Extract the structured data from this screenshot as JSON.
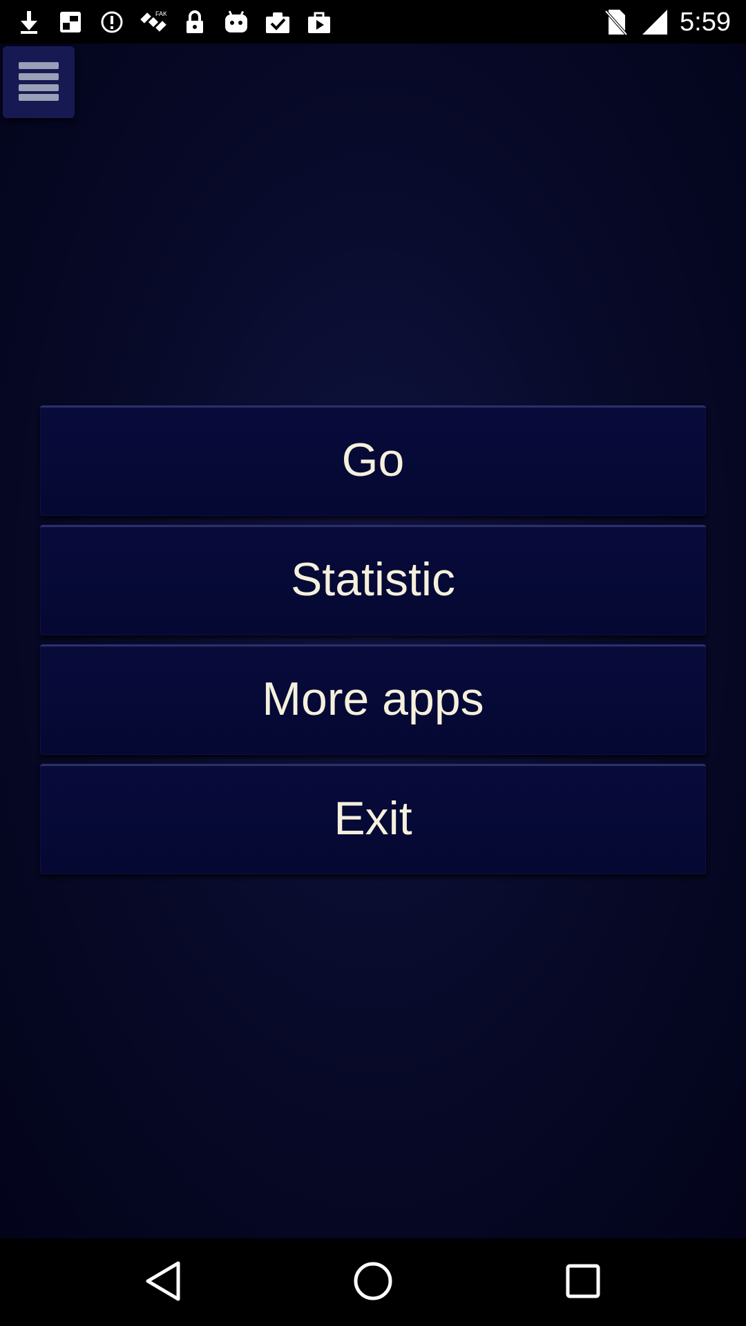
{
  "status_bar": {
    "time": "5:59",
    "left_icons": [
      "download-icon",
      "photos-icon",
      "alert-circle-icon",
      "satellite-icon",
      "lock-icon",
      "android-icon",
      "clipboard-check-icon",
      "bag-play-icon"
    ],
    "right_icons": [
      "no-sim-icon",
      "signal-icon"
    ]
  },
  "toolbar": {
    "menu_icon": "hamburger-menu-icon"
  },
  "menu": {
    "items": [
      {
        "label": "Go"
      },
      {
        "label": "Statistic"
      },
      {
        "label": "More apps"
      },
      {
        "label": "Exit"
      }
    ]
  },
  "nav_bar": {
    "buttons": [
      "back-icon",
      "home-icon",
      "recents-icon"
    ]
  },
  "colors": {
    "background": "#070927",
    "button_bg": "#080b3a",
    "button_text": "#f5f0dc",
    "menu_button_bg": "#171a52"
  }
}
